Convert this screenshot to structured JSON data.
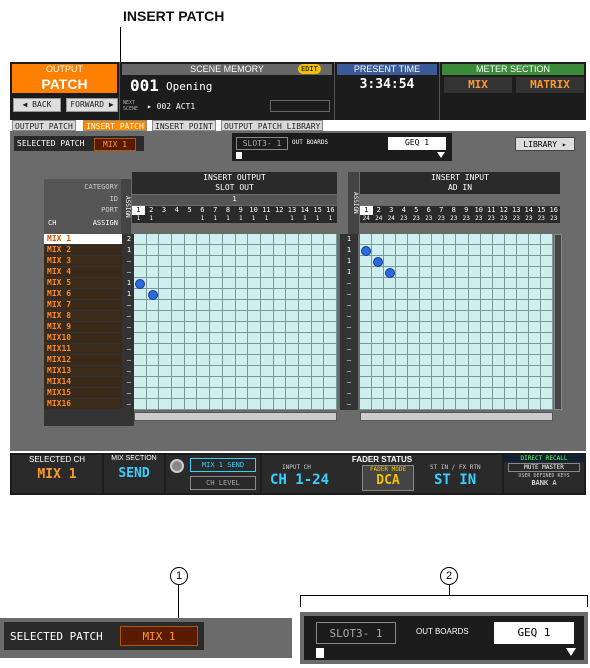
{
  "callout_top": "INSERT PATCH",
  "header": {
    "output_label": "OUTPUT",
    "patch_label": "PATCH",
    "back_label": "◀ BACK",
    "forward_label": "FORWARD ▶",
    "scene_memory_label": "SCENE MEMORY",
    "edit_badge": "EDIT",
    "scene_number": "001",
    "scene_name": "Opening",
    "next_scene_label": "NEXT SCENE",
    "next_scene": "▸ 002 ACT1",
    "present_time_label": "PRESENT TIME",
    "present_time": "3:34:54",
    "meter_section_label": "METER SECTION",
    "meter_mix": "MIX",
    "meter_matrix": "MATRIX"
  },
  "tabs": [
    {
      "label": "OUTPUT PATCH",
      "active": false
    },
    {
      "label": "INSERT PATCH",
      "active": true
    },
    {
      "label": "INSERT POINT",
      "active": false
    },
    {
      "label": "OUTPUT PATCH LIBRARY",
      "active": false
    }
  ],
  "selected_patch": {
    "label": "SELECTED PATCH",
    "value": "MIX 1"
  },
  "out_boards": {
    "slot": "SLOT3- 1",
    "label": "OUT BOARDS",
    "geq": "GEQ 1"
  },
  "library_button": "LIBRARY ▸",
  "insert_output": {
    "title": "INSERT OUTPUT",
    "subtitle": "SLOT OUT",
    "id_value": "1",
    "assign_label": "ASSIGN",
    "ports": [
      "1",
      "2",
      "3",
      "4",
      "5",
      "6",
      "7",
      "8",
      "9",
      "10",
      "11",
      "12",
      "13",
      "14",
      "15",
      "16"
    ],
    "assign_counts": [
      "1",
      "1",
      "",
      "",
      "",
      "1",
      "1",
      "1",
      "1",
      "1",
      "1",
      "",
      "1",
      "1",
      "1",
      "1"
    ]
  },
  "insert_input": {
    "title": "INSERT INPUT",
    "subtitle": "AD IN",
    "assign_label": "ASSIGN",
    "ports": [
      "1",
      "2",
      "3",
      "4",
      "5",
      "6",
      "7",
      "8",
      "9",
      "10",
      "11",
      "12",
      "13",
      "14",
      "15",
      "16"
    ],
    "assign_counts": [
      "24",
      "24",
      "24",
      "23",
      "23",
      "23",
      "23",
      "23",
      "23",
      "23",
      "23",
      "23",
      "23",
      "23",
      "23",
      "23"
    ]
  },
  "row_header": {
    "category": "CATEGORY",
    "id": "ID",
    "port": "PORT",
    "ch": "CH",
    "assign": "ASSIGN"
  },
  "channels": [
    "MIX 1",
    "MIX 2",
    "MIX 3",
    "MIX 4",
    "MIX 5",
    "MIX 6",
    "MIX 7",
    "MIX 8",
    "MIX 9",
    "MIX10",
    "MIX11",
    "MIX12",
    "MIX13",
    "MIX14",
    "MIX15",
    "MIX16"
  ],
  "out_assign": [
    "2",
    "1",
    "—",
    "—",
    "1",
    "1",
    "—",
    "—",
    "—",
    "—",
    "—",
    "—",
    "—",
    "—",
    "—",
    "—"
  ],
  "in_assign": [
    "1",
    "1",
    "1",
    "1",
    "—",
    "—",
    "—",
    "—",
    "—",
    "—",
    "—",
    "—",
    "—",
    "—",
    "—",
    "—"
  ],
  "out_dots": [
    {
      "row": 5,
      "col": 1
    },
    {
      "row": 6,
      "col": 2
    }
  ],
  "in_dots": [
    {
      "row": 2,
      "col": 1
    },
    {
      "row": 3,
      "col": 2
    },
    {
      "row": 4,
      "col": 3
    }
  ],
  "status": {
    "selected_ch_label": "SELECTED CH",
    "selected_ch": "MIX 1",
    "mix_section_label": "MIX SECTION",
    "mix_section": "SEND",
    "mix_send": "MIX 1 SEND",
    "ch_level": "CH LEVEL",
    "fader_status": "FADER STATUS",
    "input_ch_label": "INPUT CH",
    "input_ch": "CH 1-24",
    "fader_mode_label": "FADER MODE",
    "fader_mode": "DCA",
    "st_in_label": "ST IN / FX RTN",
    "st_in": "ST IN",
    "direct_recall": "DIRECT RECALL",
    "mute_master": "MUTE MASTER",
    "user_defined_keys": "USER DEFINED KEYS",
    "bank": "BANK A"
  },
  "zoom": {
    "callout_1": "1",
    "callout_2": "2",
    "selected_patch_label": "SELECTED PATCH",
    "selected_patch_value": "MIX 1",
    "slot": "SLOT3- 1",
    "out_boards": "OUT BOARDS",
    "geq": "GEQ 1"
  }
}
